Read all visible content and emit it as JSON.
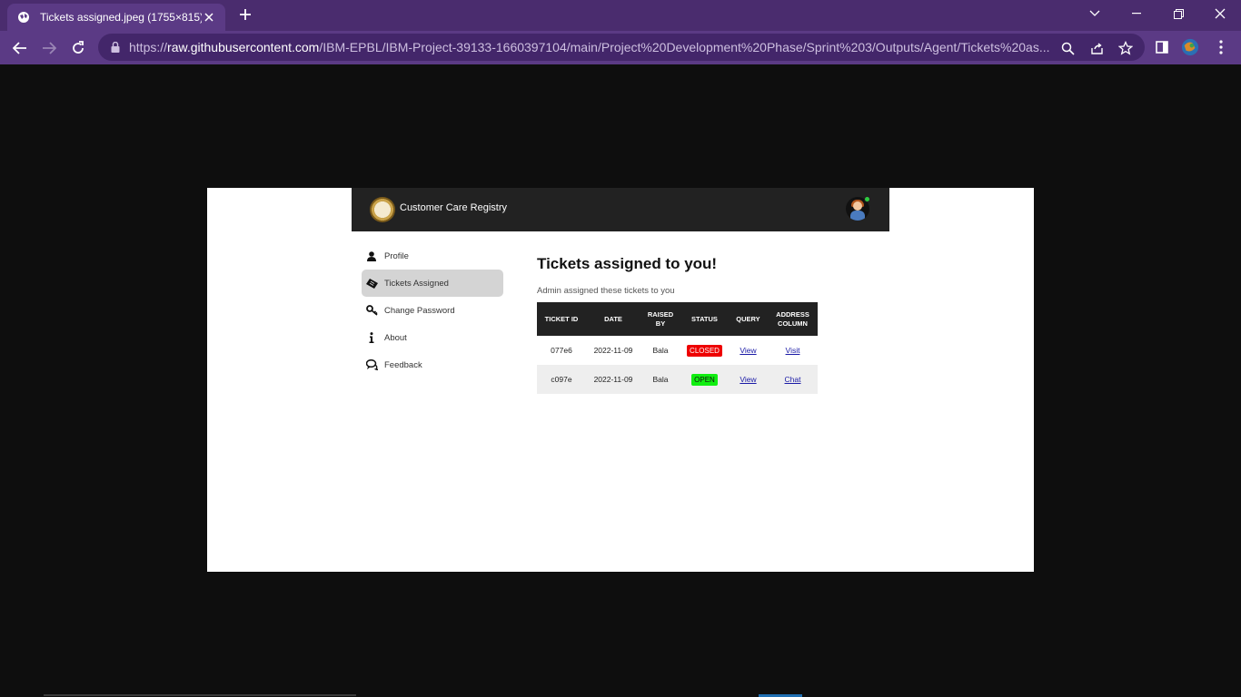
{
  "browser": {
    "tab_title": "Tickets assigned.jpeg (1755×815)",
    "url_scheme": "https://",
    "url_host": "raw.githubusercontent.com",
    "url_path": "/IBM-EPBL/IBM-Project-39133-1660397104/main/Project%20Development%20Phase/Sprint%203/Outputs/Agent/Tickets%20as...",
    "icons": [
      "globe-icon",
      "close-icon",
      "plus-icon",
      "chevron-down-icon",
      "minimize-icon",
      "restore-icon",
      "window-close-icon",
      "back-icon",
      "forward-icon",
      "reload-icon",
      "lock-icon",
      "zoom-icon",
      "share-icon",
      "star-icon",
      "sidepanel-icon",
      "profile-icon",
      "menu-icon"
    ]
  },
  "app": {
    "brand": "Customer Care Registry",
    "sidebar": [
      {
        "label": "Profile",
        "icon": "user-icon"
      },
      {
        "label": "Tickets Assigned",
        "icon": "ticket-icon",
        "active": true
      },
      {
        "label": "Change Password",
        "icon": "key-icon"
      },
      {
        "label": "About",
        "icon": "info-icon"
      },
      {
        "label": "Feedback",
        "icon": "chat-icon"
      }
    ],
    "page_title": "Tickets assigned to you!",
    "subtitle": "Admin assigned these tickets to you",
    "table": {
      "headers": [
        "TICKET ID",
        "DATE",
        "RAISED BY",
        "STATUS",
        "QUERY",
        "ADDRESS COLUMN"
      ],
      "rows": [
        {
          "id": "077e6",
          "date": "2022-11-09",
          "raised_by": "Bala",
          "status": "CLOSED",
          "query": "View",
          "address": "Visit"
        },
        {
          "id": "c097e",
          "date": "2022-11-09",
          "raised_by": "Bala",
          "status": "OPEN",
          "query": "View",
          "address": "Chat"
        }
      ]
    },
    "colors": {
      "header_bg": "#222222",
      "closed": "#ee0000",
      "open": "#11ee11",
      "chrome": "#5b3a85"
    }
  }
}
